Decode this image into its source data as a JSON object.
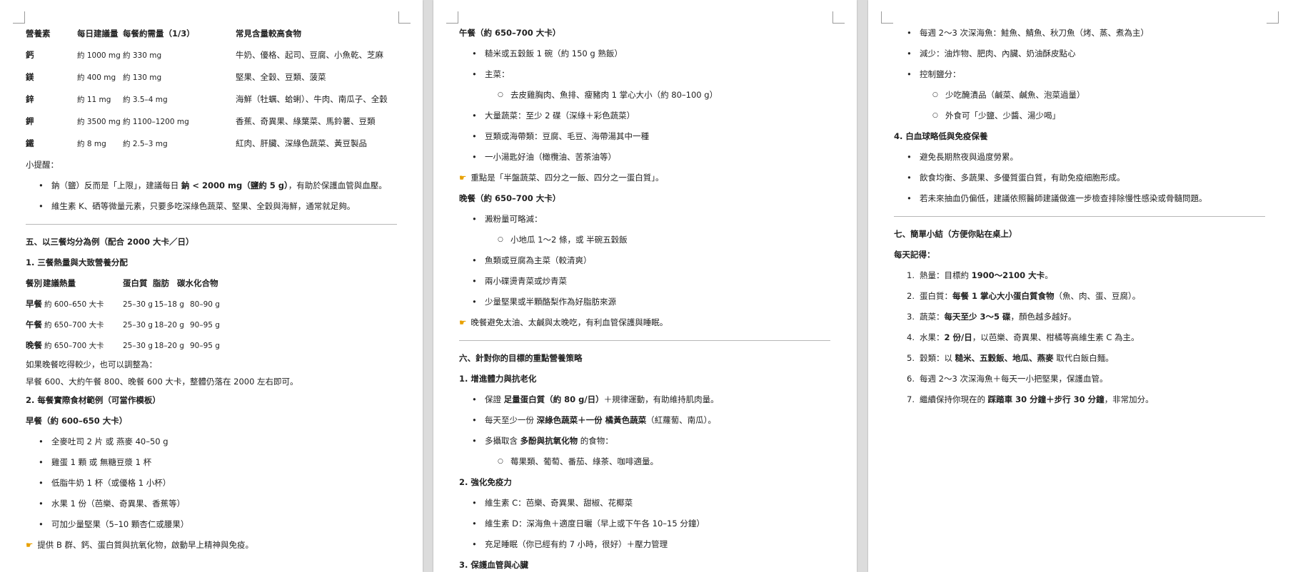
{
  "page1": {
    "table": {
      "headers": [
        "營養素",
        "每日建議量",
        "每餐約需量（1/3）",
        "常見含量較高食物"
      ],
      "rows": [
        [
          "鈣",
          "約 1000 mg",
          "約 330 mg",
          "牛奶、優格、起司、豆腐、小魚乾、芝麻"
        ],
        [
          "鎂",
          "約 400 mg",
          "約 130 mg",
          "堅果、全穀、豆類、菠菜"
        ],
        [
          "鋅",
          "約 11 mg",
          "約 3.5–4 mg",
          "海鮮（牡蠣、蛤蜊）、牛肉、南瓜子、全穀"
        ],
        [
          "鉀",
          "約 3500 mg",
          "約 1100–1200 mg",
          "香蕉、奇異果、綠葉菜、馬鈴薯、豆類"
        ],
        [
          "鐵",
          "約 8 mg",
          "約 2.5–3 mg",
          "紅肉、肝臟、深綠色蔬菜、黃豆製品"
        ]
      ]
    },
    "tip_title": "小提醒：",
    "tip_items": [
      {
        "pre": "鈉（鹽）反而是「上限」，建議每日 ",
        "bold": "鈉 < 2000 mg（鹽約 5 g）",
        "post": "，有助於保護血管與血壓。"
      },
      {
        "pre": "維生素 K、硒等微量元素，只要多吃深綠色蔬菜、堅果、全穀與海鮮，通常就足夠。",
        "bold": "",
        "post": ""
      }
    ],
    "section5_title": "五、以三餐均分為例（配合 2000 大卡／日）",
    "sub1_title": "1. 三餐熱量與大致營養分配",
    "meal_table": {
      "headers": [
        "餐別",
        "建議熱量",
        "蛋白質",
        "脂肪",
        "碳水化合物"
      ],
      "rows": [
        [
          "早餐",
          "約 600–650 大卡",
          "25–30 g",
          "15–18 g",
          "80–90 g"
        ],
        [
          "午餐",
          "約 650–700 大卡",
          "25–30 g",
          "18–20 g",
          "90–95 g"
        ],
        [
          "晚餐",
          "約 650–700 大卡",
          "25–30 g",
          "18–20 g",
          "90–95 g"
        ]
      ]
    },
    "adjust_line1": "如果晚餐吃得較少，也可以調整為：",
    "adjust_line2": "早餐 600、大約午餐 800、晚餐 600 大卡，整體仍落在 2000 左右即可。",
    "sub2_title": "2. 每餐實際食材範例（可當作模板）",
    "breakfast_title": "早餐（約 600–650 大卡）",
    "breakfast_items": [
      "全麥吐司 2 片 或 燕麥 40–50 g",
      "雞蛋 1 顆 或 無糖豆漿 1 杯",
      "低脂牛奶 1 杯（或優格 1 小杯）",
      "水果 1 份（芭樂、奇異果、香蕉等）",
      "可加少量堅果（5–10 顆杏仁或腰果）"
    ],
    "breakfast_note": "提供 B 群、鈣、蛋白質與抗氧化物，啟動早上精神與免疫。"
  },
  "page2": {
    "lunch_title": "午餐（約 650–700 大卡）",
    "lunch_items": [
      {
        "level": 1,
        "text": "糙米或五穀飯 1 碗（約 150 g 熟飯）"
      },
      {
        "level": 1,
        "text": "主菜："
      },
      {
        "level": 2,
        "text": "去皮雞胸肉、魚排、瘦豬肉 1 掌心大小（約 80–100 g）"
      },
      {
        "level": 1,
        "text": "大量蔬菜：至少 2 碟（深綠＋彩色蔬菜）"
      },
      {
        "level": 1,
        "text": "豆類或海帶類：豆腐、毛豆、海帶湯其中一種"
      },
      {
        "level": 1,
        "text": "一小湯匙好油（橄欖油、苦茶油等）"
      }
    ],
    "lunch_note": "重點是「半盤蔬菜、四分之一飯、四分之一蛋白質」。",
    "dinner_title": "晚餐（約 650–700 大卡）",
    "dinner_items": [
      {
        "level": 1,
        "text": "澱粉量可略減："
      },
      {
        "level": 2,
        "text": "小地瓜 1～2 條，或 半碗五穀飯"
      },
      {
        "level": 1,
        "text": "魚類或豆腐為主菜（較清爽）"
      },
      {
        "level": 1,
        "text": "兩小碟燙青菜或炒青菜"
      },
      {
        "level": 1,
        "text": "少量堅果或半顆酪梨作為好脂肪來源"
      }
    ],
    "dinner_note": "晚餐避免太油、太鹹與太晚吃，有利血管保護與睡眠。",
    "section6_title": "六、針對你的目標的重點營養策略",
    "s6_1_title": "1. 增進體力與抗老化",
    "s6_1_items": [
      {
        "level": 1,
        "pre": "保證 ",
        "bold": "足量蛋白質（約 80 g/日）",
        "post": "＋規律運動，有助維持肌肉量。"
      },
      {
        "level": 1,
        "pre": "每天至少一份 ",
        "bold": "深綠色蔬菜＋一份 橘黃色蔬菜",
        "post": "（紅蘿蔔、南瓜）。"
      },
      {
        "level": 1,
        "pre": "多攝取含 ",
        "bold": "多酚與抗氧化物",
        "post": " 的食物："
      },
      {
        "level": 2,
        "pre": "莓果類、葡萄、番茄、綠茶、咖啡適量。",
        "bold": "",
        "post": ""
      }
    ],
    "s6_2_title": "2. 強化免疫力",
    "s6_2_items": [
      "維生素 C：芭樂、奇異果、甜椒、花椰菜",
      "維生素 D：深海魚＋適度日曬（早上或下午各 10–15 分鐘）",
      "充足睡眠（你已經有約 7 小時，很好）＋壓力管理"
    ],
    "s6_3_title": "3. 保護血管與心臟"
  },
  "page3": {
    "top_items": [
      {
        "level": 1,
        "text": "每週 2～3 次深海魚：鮭魚、鯖魚、秋刀魚（烤、蒸、煮為主）"
      },
      {
        "level": 1,
        "text": "減少：油炸物、肥肉、內臟、奶油酥皮點心"
      },
      {
        "level": 1,
        "text": "控制鹽分："
      },
      {
        "level": 2,
        "text": "少吃醃漬品（鹹菜、鹹魚、泡菜過量）"
      },
      {
        "level": 2,
        "text": "外食可「少鹽、少醬、湯少喝」"
      }
    ],
    "s6_4_title": "4. 白血球略低與免疫保養",
    "s6_4_items": [
      "避免長期熬夜與過度勞累。",
      "飲食均衡、多蔬果、多優質蛋白質，有助免疫細胞形成。",
      "若未來抽血仍偏低，建議依照醫師建議做進一步檢查排除慢性感染或骨髓問題。"
    ],
    "section7_title": "七、簡單小結（方便你貼在桌上）",
    "daily_title": "每天記得：",
    "daily_items": [
      {
        "n": "1.",
        "pre": "熱量：目標約 ",
        "bold": "1900～2100 大卡",
        "post": "。"
      },
      {
        "n": "2.",
        "pre": "蛋白質：",
        "bold": "每餐 1 掌心大小蛋白質食物",
        "post": "（魚、肉、蛋、豆腐）。"
      },
      {
        "n": "3.",
        "pre": "蔬菜：",
        "bold": "每天至少 3～5 碟",
        "post": "，顏色越多越好。"
      },
      {
        "n": "4.",
        "pre": "水果：",
        "bold": "2 份/日",
        "post": "，以芭樂、奇異果、柑橘等高維生素 C 為主。"
      },
      {
        "n": "5.",
        "pre": "穀類：以 ",
        "bold": "糙米、五穀飯、地瓜、燕麥",
        "post": " 取代白飯白麵。"
      },
      {
        "n": "6.",
        "pre": "每週 2～3 次深海魚＋每天一小把堅果，保護血管。",
        "bold": "",
        "post": ""
      },
      {
        "n": "7.",
        "pre": "繼續保持你現在的 ",
        "bold": "踩踏車 30 分鐘＋步行 30 分鐘",
        "post": "，非常加分。"
      }
    ]
  }
}
